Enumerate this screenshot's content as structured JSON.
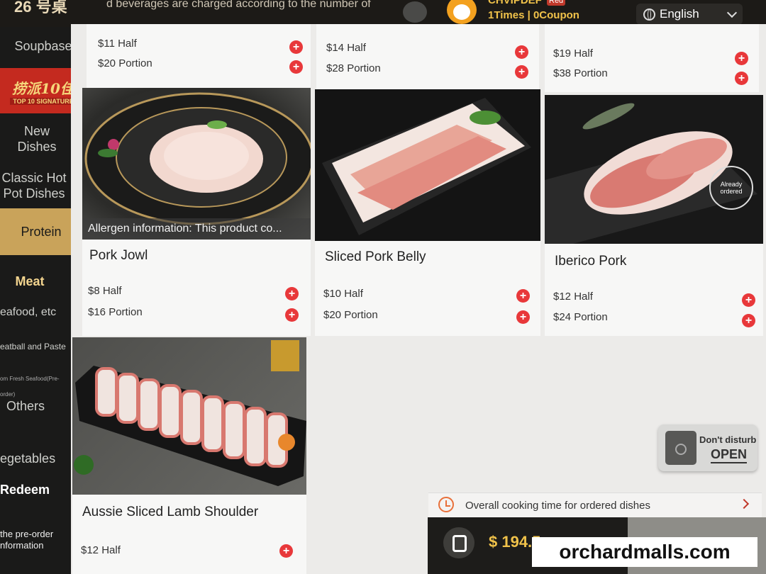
{
  "header": {
    "table_number": "26 号桌",
    "notice": "d beverages are charged according to the number of",
    "user_name": "CHVIPDEF",
    "vip_badge": "Red",
    "user_stats": "1Times  |  0Coupon",
    "language": "English"
  },
  "sidebar": {
    "items": [
      {
        "label": "Soupbase"
      },
      {
        "label": "New Dishes"
      },
      {
        "label": "Classic Hot Pot Dishes"
      },
      {
        "label": "Protein"
      },
      {
        "label": "Meat"
      },
      {
        "label": "eafood, etc"
      },
      {
        "label": "eatball and Paste"
      },
      {
        "label": "om Fresh Seafood(Pre-order)"
      },
      {
        "label": "Others"
      },
      {
        "label": "egetables"
      },
      {
        "label": "Redeem"
      },
      {
        "label": "the pre-order nformation"
      }
    ],
    "signature": {
      "title": "捞派10佳",
      "subtitle": "TOP 10 SIGNATURE"
    }
  },
  "top_row": [
    {
      "half": "$11 Half",
      "portion": "$20 Portion"
    },
    {
      "half": "$14 Half",
      "portion": "$28 Portion"
    },
    {
      "half": "$19 Half",
      "portion": "$38 Portion"
    }
  ],
  "dishes": [
    {
      "name": "Pork Jowl",
      "half": "$8 Half",
      "portion": "$16 Portion",
      "allergen": "Allergen information: This product co..."
    },
    {
      "name": "Sliced Pork Belly",
      "half": "$10 Half",
      "portion": "$20 Portion"
    },
    {
      "name": "Iberico Pork",
      "half": "$12 Half",
      "portion": "$24 Portion",
      "stamp": "Already ordered"
    },
    {
      "name": "Aussie Sliced Lamb Shoulder",
      "half": "$12 Half"
    }
  ],
  "footer": {
    "dnd_label": "Don't disturb",
    "dnd_state": "OPEN",
    "cooking_time": "Overall cooking time for ordered dishes",
    "cart_total": "$ 194.5"
  },
  "watermark": "orchardmalls.com",
  "colors": {
    "accent": "#c9a35a",
    "add_button": "#e8383a",
    "brand_red": "#c42a1f",
    "price_gold": "#f0c24a"
  }
}
